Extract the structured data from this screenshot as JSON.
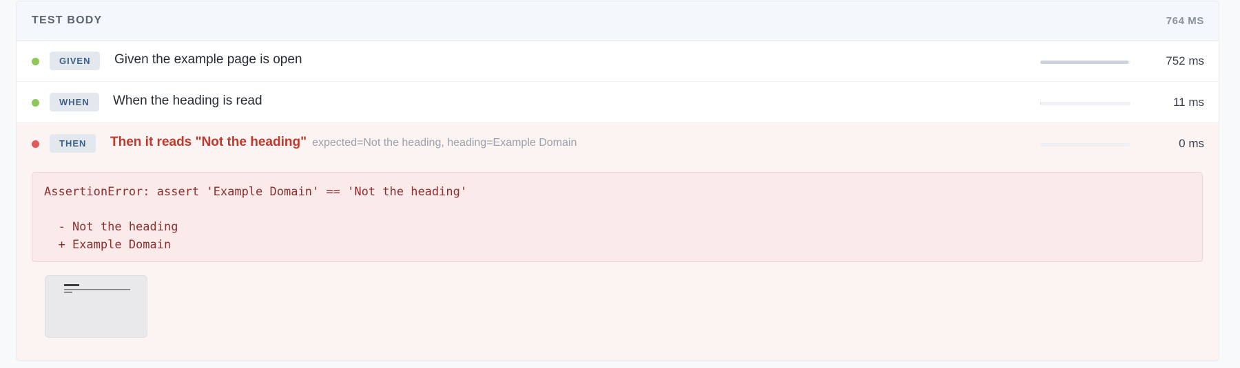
{
  "section": {
    "title": "TEST BODY",
    "duration": "764 MS"
  },
  "steps": [
    {
      "keyword": "GIVEN",
      "text": "Given the example page is open",
      "params": "",
      "duration": "752 ms",
      "status": "passed",
      "progress": 0.98
    },
    {
      "keyword": "WHEN",
      "text": "When the heading is read",
      "params": "",
      "duration": "11 ms",
      "status": "passed",
      "progress": 0.01
    },
    {
      "keyword": "THEN",
      "text": "Then it reads \"Not the heading\"",
      "params": "expected=Not the heading, heading=Example Domain",
      "duration": "0 ms",
      "status": "failed",
      "progress": 0
    }
  ],
  "failure": {
    "message": "AssertionError: assert 'Example Domain' == 'Not the heading'\n\n  - Not the heading\n  + Example Domain"
  },
  "colors": {
    "passed": "#8fc75a",
    "failed": "#e05a5a",
    "keyword": "#3e5f86",
    "failed_text": "#c0392b"
  },
  "icons": {
    "status_dot": "circle"
  }
}
